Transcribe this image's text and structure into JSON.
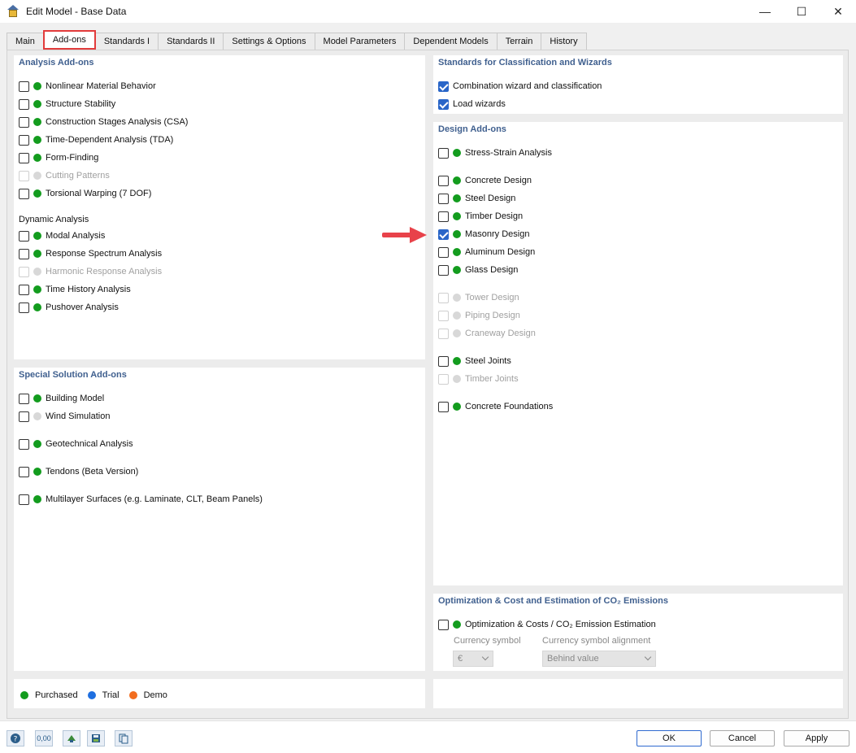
{
  "window": {
    "title": "Edit Model - Base Data",
    "minimize": "—",
    "maximize": "☐",
    "close": "✕"
  },
  "tabs": [
    {
      "label": "Main",
      "active": false
    },
    {
      "label": "Add-ons",
      "active": true
    },
    {
      "label": "Standards I",
      "active": false
    },
    {
      "label": "Standards II",
      "active": false
    },
    {
      "label": "Settings & Options",
      "active": false
    },
    {
      "label": "Model Parameters",
      "active": false
    },
    {
      "label": "Dependent Models",
      "active": false
    },
    {
      "label": "Terrain",
      "active": false
    },
    {
      "label": "History",
      "active": false
    }
  ],
  "analysis_addons": {
    "title": "Analysis Add-ons",
    "items": [
      {
        "label": "Nonlinear Material Behavior",
        "checked": false,
        "enabled": true
      },
      {
        "label": "Structure Stability",
        "checked": false,
        "enabled": true
      },
      {
        "label": "Construction Stages Analysis (CSA)",
        "checked": false,
        "enabled": true
      },
      {
        "label": "Time-Dependent Analysis (TDA)",
        "checked": false,
        "enabled": true
      },
      {
        "label": "Form-Finding",
        "checked": false,
        "enabled": true
      },
      {
        "label": "Cutting Patterns",
        "checked": false,
        "enabled": false
      },
      {
        "label": "Torsional Warping (7 DOF)",
        "checked": false,
        "enabled": true
      }
    ],
    "dynamic_title": "Dynamic Analysis",
    "dynamic_items": [
      {
        "label": "Modal Analysis",
        "checked": false,
        "enabled": true
      },
      {
        "label": "Response Spectrum Analysis",
        "checked": false,
        "enabled": true
      },
      {
        "label": "Harmonic Response Analysis",
        "checked": false,
        "enabled": false
      },
      {
        "label": "Time History Analysis",
        "checked": false,
        "enabled": true
      },
      {
        "label": "Pushover Analysis",
        "checked": false,
        "enabled": true
      }
    ]
  },
  "special_addons": {
    "title": "Special Solution Add-ons",
    "items": [
      {
        "label": "Building Model",
        "checked": false,
        "purchased": true
      },
      {
        "label": "Wind Simulation",
        "checked": false,
        "purchased": false
      },
      {
        "label": "Geotechnical Analysis",
        "checked": false,
        "purchased": true
      },
      {
        "label": "Tendons (Beta Version)",
        "checked": false,
        "purchased": true
      },
      {
        "label": "Multilayer Surfaces (e.g. Laminate, CLT, Beam Panels)",
        "checked": false,
        "purchased": true
      }
    ]
  },
  "standards_wizards": {
    "title": "Standards for Classification and Wizards",
    "items": [
      {
        "label": "Combination wizard and classification",
        "checked": true
      },
      {
        "label": "Load wizards",
        "checked": true
      }
    ]
  },
  "design_addons": {
    "title": "Design Add-ons",
    "items": [
      {
        "label": "Stress-Strain Analysis",
        "checked": false,
        "enabled": true
      },
      {
        "label": "Concrete Design",
        "checked": false,
        "enabled": true
      },
      {
        "label": "Steel Design",
        "checked": false,
        "enabled": true
      },
      {
        "label": "Timber Design",
        "checked": false,
        "enabled": true
      },
      {
        "label": "Masonry Design",
        "checked": true,
        "enabled": true
      },
      {
        "label": "Aluminum Design",
        "checked": false,
        "enabled": true
      },
      {
        "label": "Glass Design",
        "checked": false,
        "enabled": true
      },
      {
        "label": "Tower Design",
        "checked": false,
        "enabled": false
      },
      {
        "label": "Piping Design",
        "checked": false,
        "enabled": false
      },
      {
        "label": "Craneway Design",
        "checked": false,
        "enabled": false
      },
      {
        "label": "Steel Joints",
        "checked": false,
        "enabled": true
      },
      {
        "label": "Timber Joints",
        "checked": false,
        "enabled": false
      },
      {
        "label": "Concrete Foundations",
        "checked": false,
        "enabled": true
      }
    ]
  },
  "optimization": {
    "title": "Optimization & Cost and Estimation of CO₂ Emissions",
    "item": {
      "label": "Optimization & Costs / CO₂ Emission Estimation",
      "checked": false
    },
    "currency_label": "Currency symbol",
    "currency_value": "€",
    "alignment_label": "Currency symbol alignment",
    "alignment_value": "Behind value"
  },
  "legend": [
    {
      "label": "Purchased",
      "color": "#139c1e"
    },
    {
      "label": "Trial",
      "color": "#1f6fe0"
    },
    {
      "label": "Demo",
      "color": "#f26d1f"
    }
  ],
  "toolbar_icons": [
    "help-icon",
    "units-icon",
    "model-icon",
    "save-template-icon",
    "copy-data-icon"
  ],
  "toolbar_units_text": "0,00",
  "buttons": {
    "ok": "OK",
    "cancel": "Cancel",
    "apply": "Apply"
  }
}
